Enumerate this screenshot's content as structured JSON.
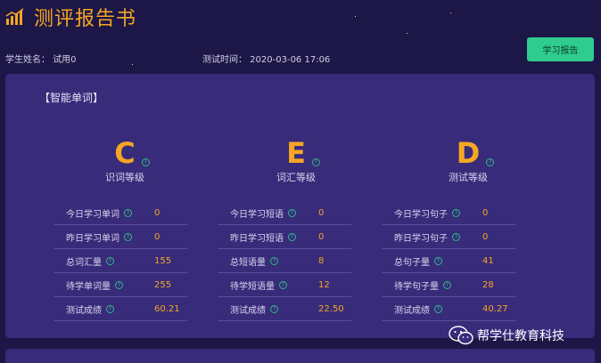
{
  "header": {
    "title": "测评报告书",
    "student_name": "学生姓名：  试用0",
    "test_time": "测试时间：  2020-03-06 17:06",
    "report_button": "学习报告"
  },
  "section": {
    "title": "【智能单词】"
  },
  "grades": [
    {
      "letter": "C",
      "label": "识词等级"
    },
    {
      "letter": "E",
      "label": "词汇等级"
    },
    {
      "letter": "D",
      "label": "测试等级"
    }
  ],
  "stats": [
    [
      {
        "label": "今日学习单词",
        "value": "0"
      },
      {
        "label": "昨日学习单词",
        "value": "0"
      },
      {
        "label": "总词汇量",
        "value": "155"
      },
      {
        "label": "待学单词量",
        "value": "255"
      },
      {
        "label": "测试成绩",
        "value": "60.21"
      }
    ],
    [
      {
        "label": "今日学习短语",
        "value": "0"
      },
      {
        "label": "昨日学习短语",
        "value": "0"
      },
      {
        "label": "总短语量",
        "value": "8"
      },
      {
        "label": "待学短语量",
        "value": "12"
      },
      {
        "label": "测试成绩",
        "value": "22.50"
      }
    ],
    [
      {
        "label": "今日学习句子",
        "value": "0"
      },
      {
        "label": "昨日学习句子",
        "value": "0"
      },
      {
        "label": "总句子量",
        "value": "41"
      },
      {
        "label": "待学句子量",
        "value": "28"
      },
      {
        "label": "测试成绩",
        "value": "40.27"
      }
    ]
  ],
  "help_icon_glyph": "?",
  "watermark": {
    "text": "帮学仕教育科技",
    "icon": "wechat-icon"
  },
  "colors": {
    "background": "#1d1747",
    "panel": "#372b7a",
    "accent": "#f5a623",
    "button": "#2ecc8f"
  }
}
